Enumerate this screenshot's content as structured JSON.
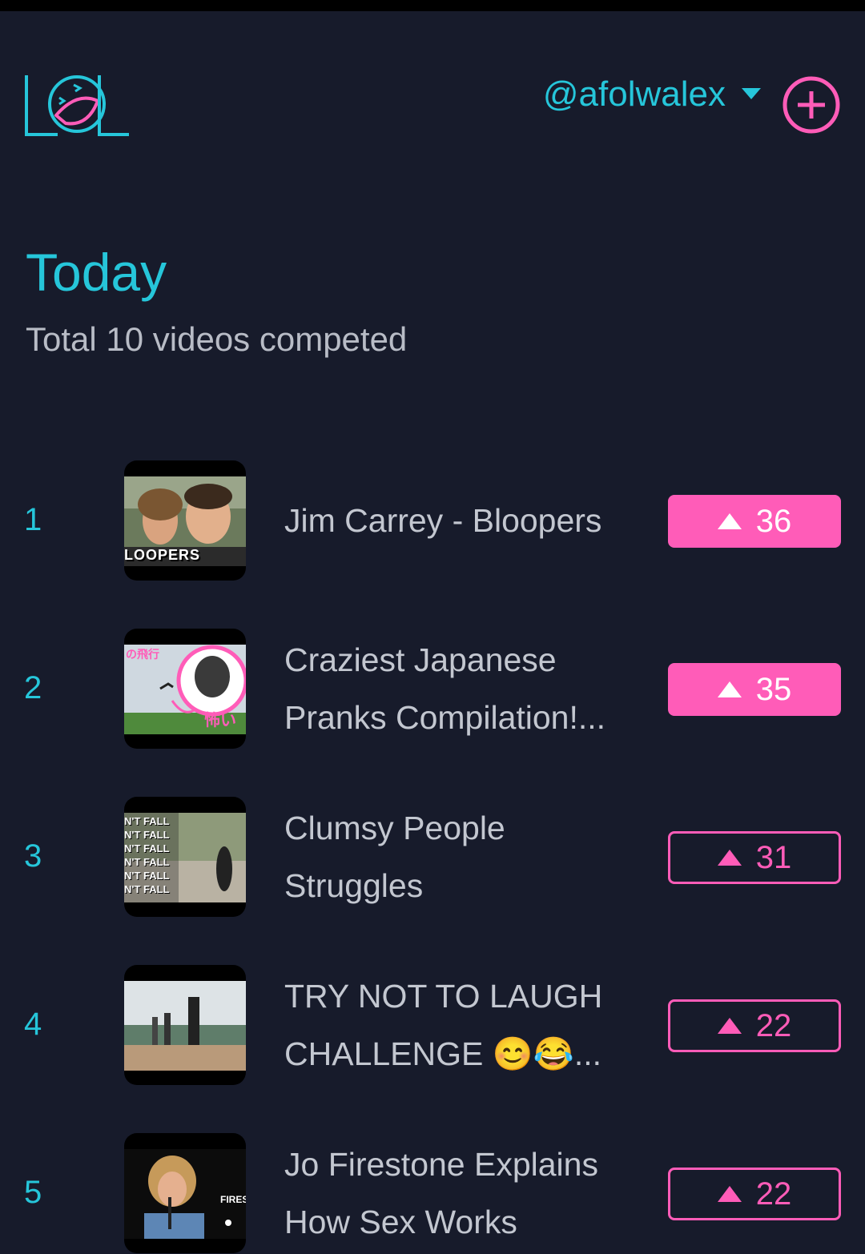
{
  "header": {
    "logo_icon": "lol-logo-icon",
    "username": "@afolwalex",
    "add_icon": "plus-circle-icon",
    "accent": "#26c6da",
    "pink": "#ff5cb8"
  },
  "main": {
    "title": "Today",
    "subtitle": "Total 10 videos competed"
  },
  "videos": [
    {
      "rank": "1",
      "title": "Jim Carrey - Bloopers",
      "votes": "36",
      "thumb_text": "LOOPERS",
      "style": "filled"
    },
    {
      "rank": "2",
      "title": "Craziest Japanese Pranks Compilation!...",
      "votes": "35",
      "thumb_text": "の飛行",
      "thumb_text2": "怖い",
      "style": "filled"
    },
    {
      "rank": "3",
      "title": "Clumsy People Struggles",
      "votes": "31",
      "thumb_text": "N'T FALL",
      "style": "outline"
    },
    {
      "rank": "4",
      "title": "TRY NOT TO LAUGH CHALLENGE 😊😂...",
      "votes": "22",
      "style": "outline"
    },
    {
      "rank": "5",
      "title": "Jo Firestone Explains How Sex Works",
      "votes": "22",
      "thumb_text": "FIREST",
      "style": "outline"
    }
  ]
}
